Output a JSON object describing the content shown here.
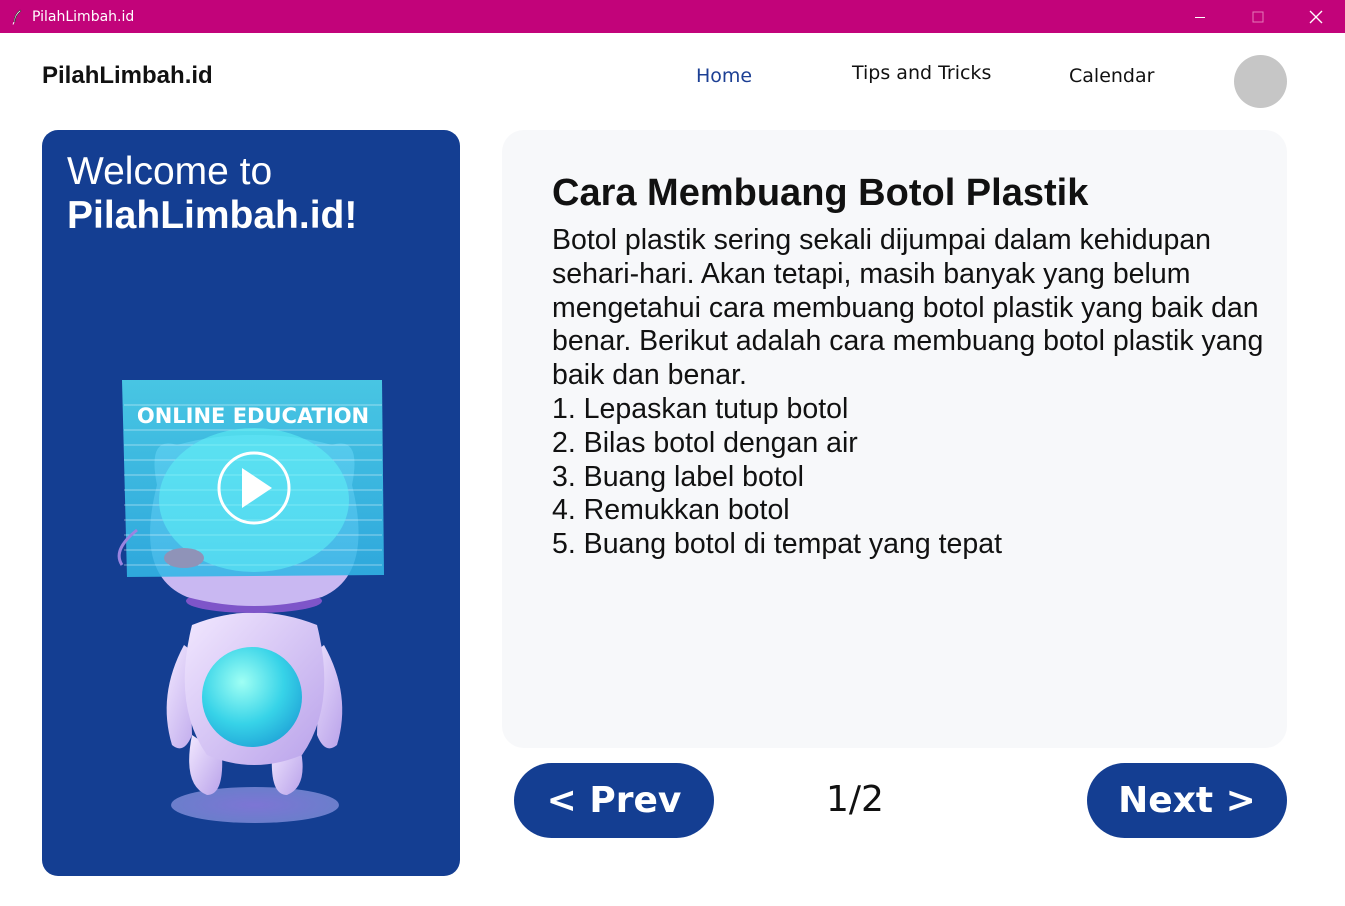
{
  "window": {
    "title": "PilahLimbah.id",
    "icon": "feather-icon",
    "controls": [
      "minimize-icon",
      "maximize-icon",
      "close-icon"
    ],
    "titlebar_color": "#c2037a"
  },
  "header": {
    "brand": "PilahLimbah.id",
    "nav": {
      "home": "Home",
      "tips": "Tips and Tricks",
      "calendar": "Calendar"
    },
    "active_nav": "Home",
    "active_color": "#1c3f94"
  },
  "welcome": {
    "line1": "Welcome to",
    "line2": "PilahLimbah.id!",
    "illustration_text": "ONLINE EDUCATION",
    "panel_color": "#143e92"
  },
  "article": {
    "title": "Cara Membuang Botol Plastik",
    "intro": "Botol plastik sering sekali dijumpai dalam kehidupan sehari-hari. Akan tetapi, masih banyak yang belum mengetahui cara membuang botol plastik yang baik dan benar. Berikut adalah cara membuang botol plastik yang baik dan benar.",
    "steps": [
      "1. Lepaskan tutup botol",
      "2. Bilas botol dengan air",
      "3. Buang label botol",
      "4. Remukkan botol",
      "5. Buang botol di tempat yang tepat"
    ]
  },
  "pagination": {
    "prev_label": "< Prev",
    "next_label": "Next >",
    "indicator": "1/2"
  }
}
